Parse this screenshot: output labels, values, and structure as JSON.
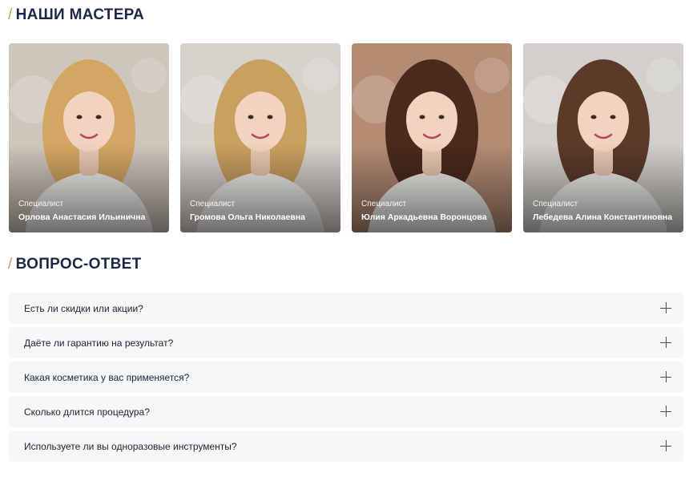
{
  "masters_section": {
    "slash": "/",
    "title": "НАШИ МАСТЕРА",
    "cards": [
      {
        "role": "Специалист",
        "name": "Орлова Анастасия Ильинична",
        "hair": "#d4a664",
        "bg": "#cfc6bb"
      },
      {
        "role": "Специалист",
        "name": "Громова Ольга Николаевна",
        "hair": "#c9a060",
        "bg": "#d8d2cc"
      },
      {
        "role": "Специалист",
        "name": "Юлия Аркадьевна Воронцова",
        "hair": "#4a2a1c",
        "bg": "#b48c74"
      },
      {
        "role": "Специалист",
        "name": "Лебедева Алина Константиновна",
        "hair": "#5b3a2a",
        "bg": "#d3d0cc"
      }
    ]
  },
  "faq_section": {
    "slash": "/",
    "title": "ВОПРОС-ОТВЕТ",
    "items": [
      {
        "question": "Есть ли скидки или акции?"
      },
      {
        "question": "Даёте ли гарантию на результат?"
      },
      {
        "question": "Какая косметика у вас применяется?"
      },
      {
        "question": "Сколько длится процедура?"
      },
      {
        "question": "Используете ли вы одноразовые инструменты?"
      }
    ]
  }
}
